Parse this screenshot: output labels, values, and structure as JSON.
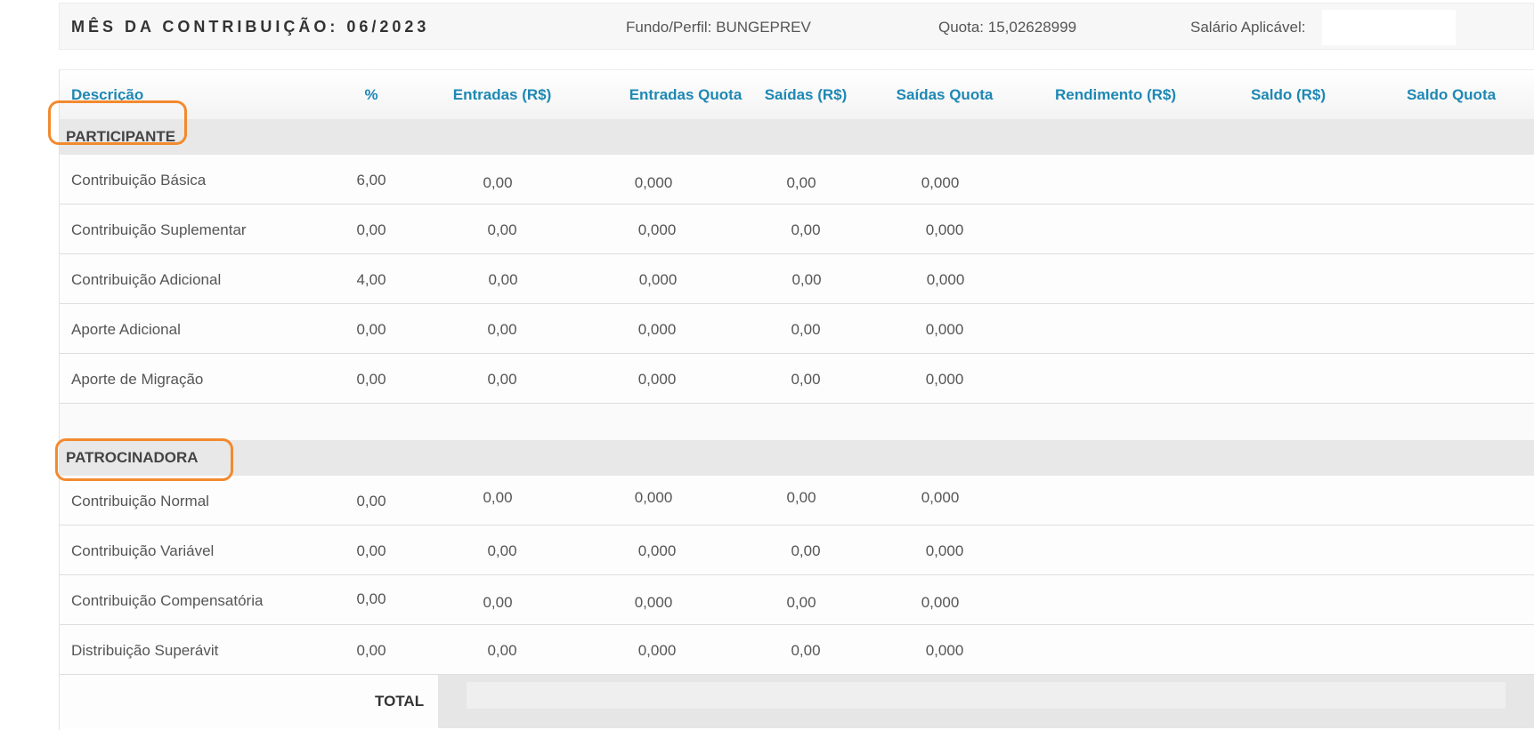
{
  "summary": {
    "month_label": "MÊS DA CONTRIBUIÇÃO: 06/2023",
    "fund_label": "Fundo/Perfil: BUNGEPREV",
    "quota_label": "Quota: 15,02628999",
    "salary_label": "Salário Aplicável:"
  },
  "columns": [
    "Descrição",
    "%",
    "Entradas (R$)",
    "Entradas Quota",
    "Saídas (R$)",
    "Saídas Quota",
    "Rendimento (R$)",
    "Saldo (R$)",
    "Saldo Quota"
  ],
  "groups": {
    "participante": {
      "label": "PARTICIPANTE",
      "rows": [
        {
          "desc": "Contribuição Básica",
          "pct": "6,00",
          "entradas": "0,00",
          "entradas_quota": "0,000",
          "saidas": "0,00",
          "saidas_quota": "0,000"
        },
        {
          "desc": "Contribuição Suplementar",
          "pct": "0,00",
          "entradas": "0,00",
          "entradas_quota": "0,000",
          "saidas": "0,00",
          "saidas_quota": "0,000"
        },
        {
          "desc": "Contribuição Adicional",
          "pct": "4,00",
          "entradas": "0,00",
          "entradas_quota": "0,000",
          "saidas": "0,00",
          "saidas_quota": "0,000"
        },
        {
          "desc": "Aporte Adicional",
          "pct": "0,00",
          "entradas": "0,00",
          "entradas_quota": "0,000",
          "saidas": "0,00",
          "saidas_quota": "0,000"
        },
        {
          "desc": "Aporte de Migração",
          "pct": "0,00",
          "entradas": "0,00",
          "entradas_quota": "0,000",
          "saidas": "0,00",
          "saidas_quota": "0,000"
        }
      ]
    },
    "patrocinadora": {
      "label": "PATROCINADORA",
      "rows": [
        {
          "desc": "Contribuição Normal",
          "pct": "0,00",
          "entradas": "0,00",
          "entradas_quota": "0,000",
          "saidas": "0,00",
          "saidas_quota": "0,000"
        },
        {
          "desc": "Contribuição Variável",
          "pct": "0,00",
          "entradas": "0,00",
          "entradas_quota": "0,000",
          "saidas": "0,00",
          "saidas_quota": "0,000"
        },
        {
          "desc": "Contribuição Compensatória",
          "pct": "0,00",
          "entradas": "0,00",
          "entradas_quota": "0,000",
          "saidas": "0,00",
          "saidas_quota": "0,000"
        },
        {
          "desc": "Distribuição Superávit",
          "pct": "0,00",
          "entradas": "0,00",
          "entradas_quota": "0,000",
          "saidas": "0,00",
          "saidas_quota": "0,000"
        }
      ]
    }
  },
  "total": {
    "label": "TOTAL"
  },
  "colors": {
    "header_text": "#1e88b4",
    "highlight": "#f28a2e",
    "group_bg": "#e8e8e8"
  }
}
